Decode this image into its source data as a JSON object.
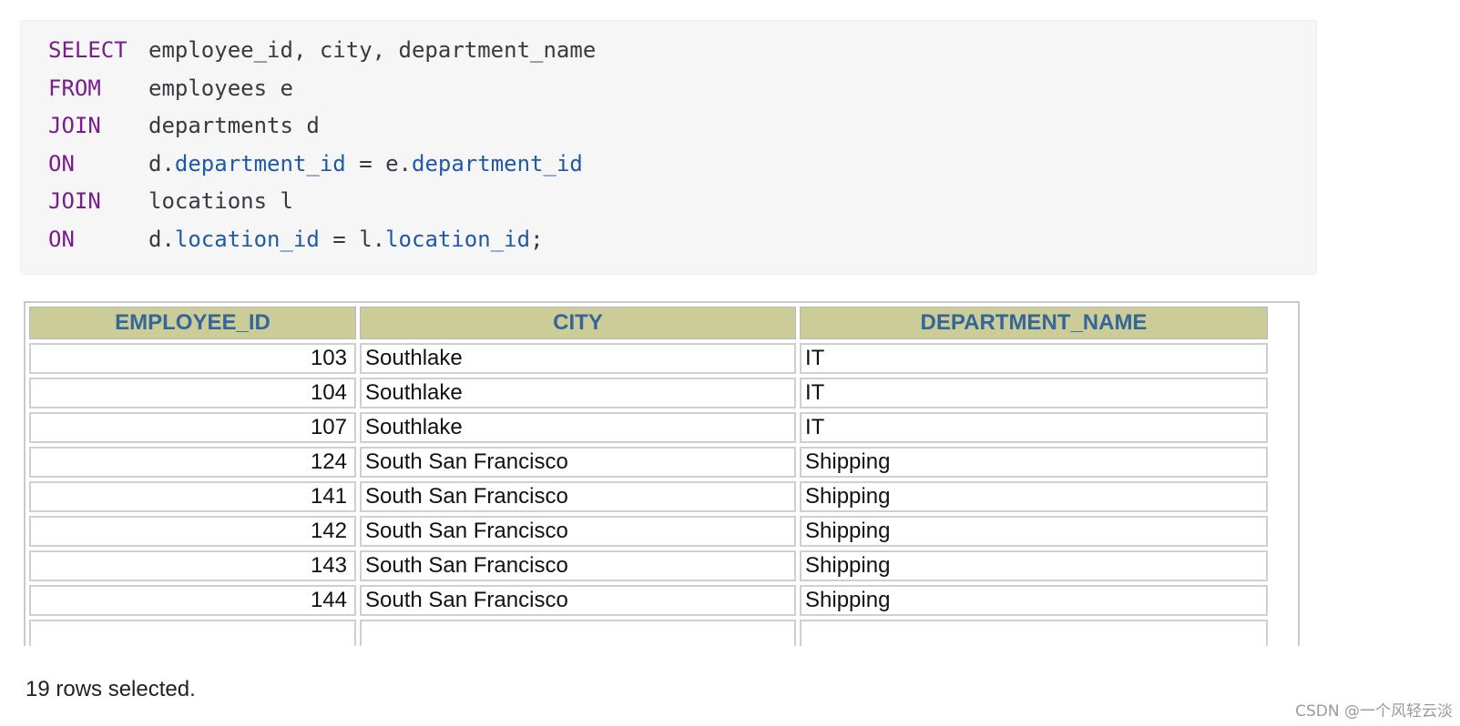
{
  "code": {
    "lines": [
      {
        "keyword": "SELECT",
        "parts": [
          {
            "text": "employee_id, city, department_name",
            "kind": "plain"
          }
        ]
      },
      {
        "keyword": "FROM",
        "parts": [
          {
            "text": "employees e",
            "kind": "plain"
          }
        ]
      },
      {
        "keyword": "JOIN",
        "parts": [
          {
            "text": "departments d",
            "kind": "plain"
          }
        ]
      },
      {
        "keyword": "ON",
        "parts": [
          {
            "text": "d.",
            "kind": "plain"
          },
          {
            "text": "department_id",
            "kind": "attr"
          },
          {
            "text": " = e.",
            "kind": "plain"
          },
          {
            "text": "department_id",
            "kind": "attr"
          }
        ]
      },
      {
        "keyword": "JOIN",
        "parts": [
          {
            "text": "locations l",
            "kind": "plain"
          }
        ]
      },
      {
        "keyword": "ON",
        "parts": [
          {
            "text": "d.",
            "kind": "plain"
          },
          {
            "text": "location_id",
            "kind": "attr"
          },
          {
            "text": " = l.",
            "kind": "plain"
          },
          {
            "text": "location_id",
            "kind": "attr"
          },
          {
            "text": ";",
            "kind": "plain"
          }
        ]
      }
    ]
  },
  "result": {
    "columns": [
      "EMPLOYEE_ID",
      "CITY",
      "DEPARTMENT_NAME"
    ],
    "rows": [
      {
        "employee_id": "103",
        "city": "Southlake",
        "department_name": "IT"
      },
      {
        "employee_id": "104",
        "city": "Southlake",
        "department_name": "IT"
      },
      {
        "employee_id": "107",
        "city": "Southlake",
        "department_name": "IT"
      },
      {
        "employee_id": "124",
        "city": "South San Francisco",
        "department_name": "Shipping"
      },
      {
        "employee_id": "141",
        "city": "South San Francisco",
        "department_name": "Shipping"
      },
      {
        "employee_id": "142",
        "city": "South San Francisco",
        "department_name": "Shipping"
      },
      {
        "employee_id": "143",
        "city": "South San Francisco",
        "department_name": "Shipping"
      },
      {
        "employee_id": "144",
        "city": "South San Francisco",
        "department_name": "Shipping"
      },
      {
        "employee_id": "",
        "city": "",
        "department_name": ""
      }
    ],
    "footer": "19 rows selected."
  },
  "watermark": "CSDN @一个风轻云淡",
  "colors": {
    "keyword": "#7a1b8e",
    "attribute": "#1e5aa8",
    "header_bg": "#cccc99",
    "header_text": "#336699"
  }
}
